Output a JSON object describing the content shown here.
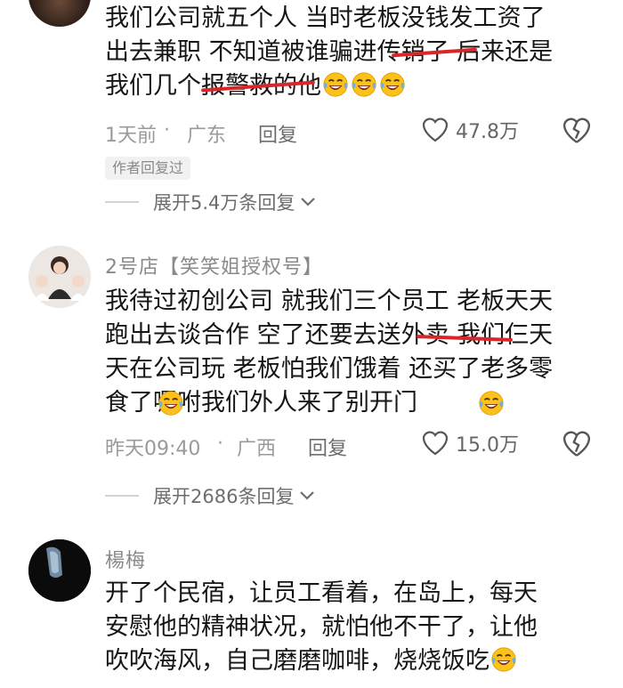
{
  "comments": [
    {
      "name": "",
      "lines": [
        "我们公司就五个人 当时老板没钱发工资了",
        "出去兼职 不知道被谁骗进传销了 后来还是",
        "我们几个报警救的他"
      ],
      "time": "1天前",
      "location": "广东",
      "reply_label": "回复",
      "likes": "47.8万",
      "badge": "作者回复过",
      "expand": "展开5.4万条回复"
    },
    {
      "name": "2号店【笑笑姐授权号】",
      "lines": [
        "我待过初创公司 就我们三个员工 老板天天",
        "跑出去谈合作 空了还要去送外卖 我们仨天",
        "天在公司玩 老板怕我们饿着 还买了老多零",
        "食了嘱咐我们外人来了别开门"
      ],
      "time": "昨天09:40",
      "location": "广西",
      "reply_label": "回复",
      "likes": "15.0万",
      "expand": "展开2686条回复"
    },
    {
      "name": "楊梅",
      "lines": [
        "开了个民宿，让员工看着，在岛上，每天",
        "安慰他的精神状况，就怕他不干了，让他",
        "吹吹海风，自己磨磨咖啡，烧烧饭吃"
      ]
    }
  ],
  "separator": "·",
  "icons": {
    "emoji": "rofl-emoji-icon",
    "like": "heart-icon",
    "dislike": "broken-heart-icon",
    "expand": "chevron-down-icon"
  },
  "colors": {
    "strike": "#d8262b",
    "meta": "#9a9a9a",
    "text": "#161616"
  }
}
